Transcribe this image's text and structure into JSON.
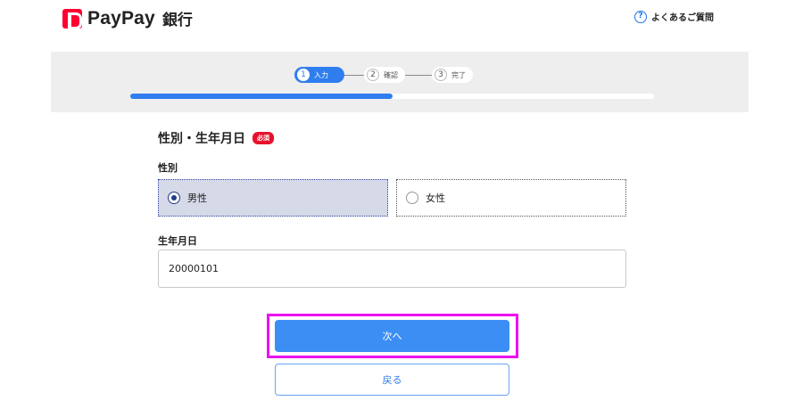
{
  "header": {
    "brand": "PayPay",
    "brand_suffix": "銀行",
    "faq_label": "よくあるご質問",
    "faq_icon": "question-circle-icon"
  },
  "stepper": {
    "steps": [
      {
        "number": "1",
        "label": "入力",
        "state": "active"
      },
      {
        "number": "2",
        "label": "確認",
        "state": "inactive"
      },
      {
        "number": "3",
        "label": "完了",
        "state": "inactive"
      }
    ],
    "progress_fraction": 0.5
  },
  "form": {
    "section_title": "性別・生年月日",
    "required_badge": "必須",
    "gender": {
      "label": "性別",
      "options": [
        {
          "label": "男性",
          "selected": true
        },
        {
          "label": "女性",
          "selected": false
        }
      ]
    },
    "birthdate": {
      "label": "生年月日",
      "value": "20000101"
    }
  },
  "actions": {
    "next_label": "次へ",
    "back_label": "戻る"
  },
  "colors": {
    "brand_red": "#ff0033",
    "primary_blue": "#2f7ef0",
    "highlight_magenta": "#ee11ee",
    "selected_bg": "#d5d9e8"
  }
}
